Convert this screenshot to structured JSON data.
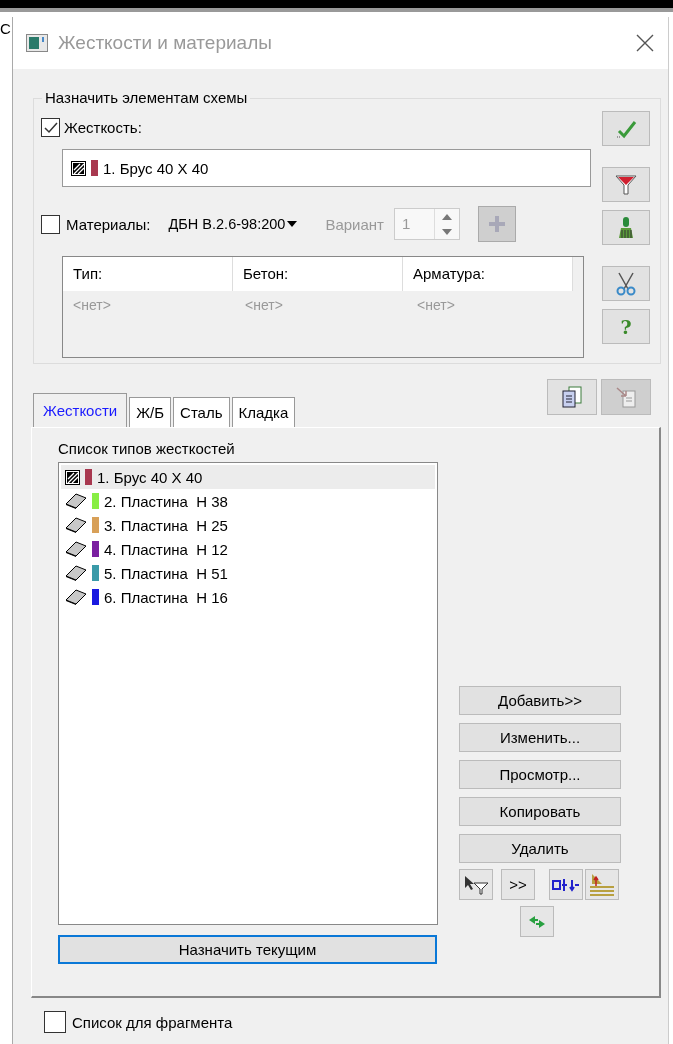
{
  "background_text": "С",
  "window": {
    "title": "Жесткости и материалы"
  },
  "assign_group": {
    "title": "Назначить элементам схемы",
    "stiffness": {
      "label": "Жесткость:",
      "checked": true,
      "value": {
        "kind": "bar",
        "color": "#a8384f",
        "text": "1. Брус 40 X 40"
      }
    },
    "materials": {
      "label": "Материалы:",
      "checked": false,
      "norm": "ДБН В.2.6-98:200",
      "variant_label": "Вариант",
      "variant": "1",
      "disabled": true
    },
    "table": {
      "columns": [
        "Тип:",
        "Бетон:",
        "Арматура:"
      ],
      "rows": [
        [
          "<нет>",
          "<нет>",
          "<нет>"
        ]
      ]
    },
    "side_buttons": [
      {
        "kind": "check"
      },
      {
        "kind": "filter"
      },
      {
        "kind": "brush"
      },
      {
        "kind": "scissors"
      },
      {
        "kind": "help",
        "label": "?"
      }
    ]
  },
  "tab_toolbar": [
    {
      "kind": "copy",
      "disabled": false
    },
    {
      "kind": "paste",
      "disabled": true
    }
  ],
  "tabs": [
    {
      "label": "Жесткости",
      "selected": true
    },
    {
      "label": "Ж/Б",
      "selected": false
    },
    {
      "label": "Сталь",
      "selected": false
    },
    {
      "label": "Кладка",
      "selected": false
    }
  ],
  "stiffness_list": {
    "title": "Список типов жесткостей",
    "items": [
      {
        "kind": "bar",
        "color": "#a8384f",
        "text": "1. Брус 40 X 40",
        "selected": true
      },
      {
        "kind": "plate",
        "color": "#88ee44",
        "text": "2. Пластина  H 38",
        "selected": false
      },
      {
        "kind": "plate",
        "color": "#d8a058",
        "text": "3. Пластина  H 25",
        "selected": false
      },
      {
        "kind": "plate",
        "color": "#7a1fa0",
        "text": "4. Пластина  H 12",
        "selected": false
      },
      {
        "kind": "plate",
        "color": "#3a9aa8",
        "text": "5. Пластина  H 51",
        "selected": false
      },
      {
        "kind": "plate",
        "color": "#1a1ae0",
        "text": "6. Пластина  H 16",
        "selected": false
      }
    ]
  },
  "action_buttons": [
    "Добавить>>",
    "Изменить...",
    "Просмотр...",
    "Копировать",
    "Удалить"
  ],
  "tool_buttons": [
    {
      "kind": "select-filter"
    },
    {
      "kind": "text",
      "label": ">>"
    },
    {
      "kind": "align"
    },
    {
      "kind": "levels"
    },
    {
      "kind": "refresh"
    }
  ],
  "assign_button": {
    "label": "Назначить текущим",
    "focused": true
  },
  "fragment": {
    "label": "Список для фрагмента",
    "checked": false
  }
}
